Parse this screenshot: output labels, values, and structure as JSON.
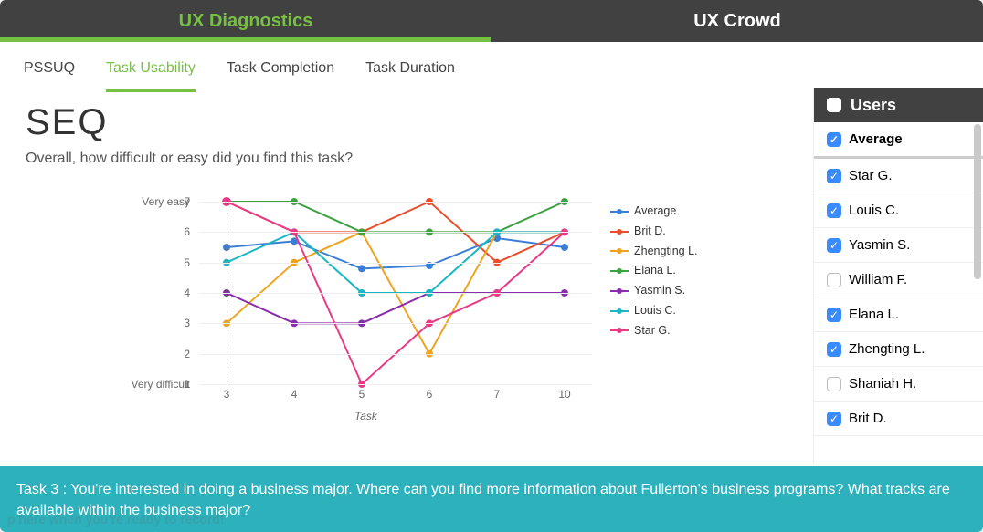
{
  "topnav": {
    "active": "UX Diagnostics",
    "tabs": [
      "UX Diagnostics",
      "UX Crowd"
    ]
  },
  "subnav": {
    "active": "Task Usability",
    "items": [
      "PSSUQ",
      "Task Usability",
      "Task Completion",
      "Task Duration"
    ]
  },
  "title": "SEQ",
  "question": "Overall, how difficult or easy did you find this task?",
  "ylabels": {
    "top": "Very easy",
    "bottom": "Very difficult"
  },
  "xlabel": "Task",
  "users_header": "Users",
  "average_label": "Average",
  "users": [
    {
      "name": "Star G.",
      "checked": true
    },
    {
      "name": "Louis C.",
      "checked": true
    },
    {
      "name": "Yasmin S.",
      "checked": true
    },
    {
      "name": "William F.",
      "checked": false
    },
    {
      "name": "Elana L.",
      "checked": true
    },
    {
      "name": "Zhengting L.",
      "checked": true
    },
    {
      "name": "Shaniah H.",
      "checked": false
    },
    {
      "name": "Brit D.",
      "checked": true
    }
  ],
  "footer": "Task 3 : You're interested in doing a business major. Where can you find more information about Fullerton's business programs? What tracks are available within the business major?",
  "ghost_text": "p here when you're ready to record!",
  "chart_data": {
    "type": "line",
    "title": "SEQ",
    "xlabel": "Task",
    "ylabel": "",
    "ylim": [
      1,
      7
    ],
    "ytick_labels": {
      "7": "Very easy",
      "1": "Very difficult"
    },
    "categories": [
      "3",
      "4",
      "5",
      "6",
      "7",
      "10"
    ],
    "series": [
      {
        "name": "Average",
        "color": "#3a7ed6",
        "values": [
          5.5,
          5.7,
          4.8,
          4.9,
          5.8,
          5.5
        ]
      },
      {
        "name": "Brit D.",
        "color": "#ea4e2c",
        "values": [
          7,
          6,
          6,
          7,
          5,
          6
        ]
      },
      {
        "name": "Zhengting L.",
        "color": "#f0a31f",
        "values": [
          3,
          5,
          6,
          2,
          6,
          6
        ]
      },
      {
        "name": "Elana L.",
        "color": "#3aa241",
        "values": [
          7,
          7,
          6,
          6,
          6,
          7
        ]
      },
      {
        "name": "Yasmin S.",
        "color": "#8a2dad",
        "values": [
          4,
          3,
          3,
          4,
          4,
          4
        ]
      },
      {
        "name": "Louis C.",
        "color": "#1bb6c4",
        "values": [
          5,
          6,
          4,
          4,
          6,
          6
        ]
      },
      {
        "name": "Star G.",
        "color": "#ea3a87",
        "values": [
          7,
          6,
          1,
          3,
          4,
          6
        ]
      }
    ],
    "highlight_x": "3"
  }
}
